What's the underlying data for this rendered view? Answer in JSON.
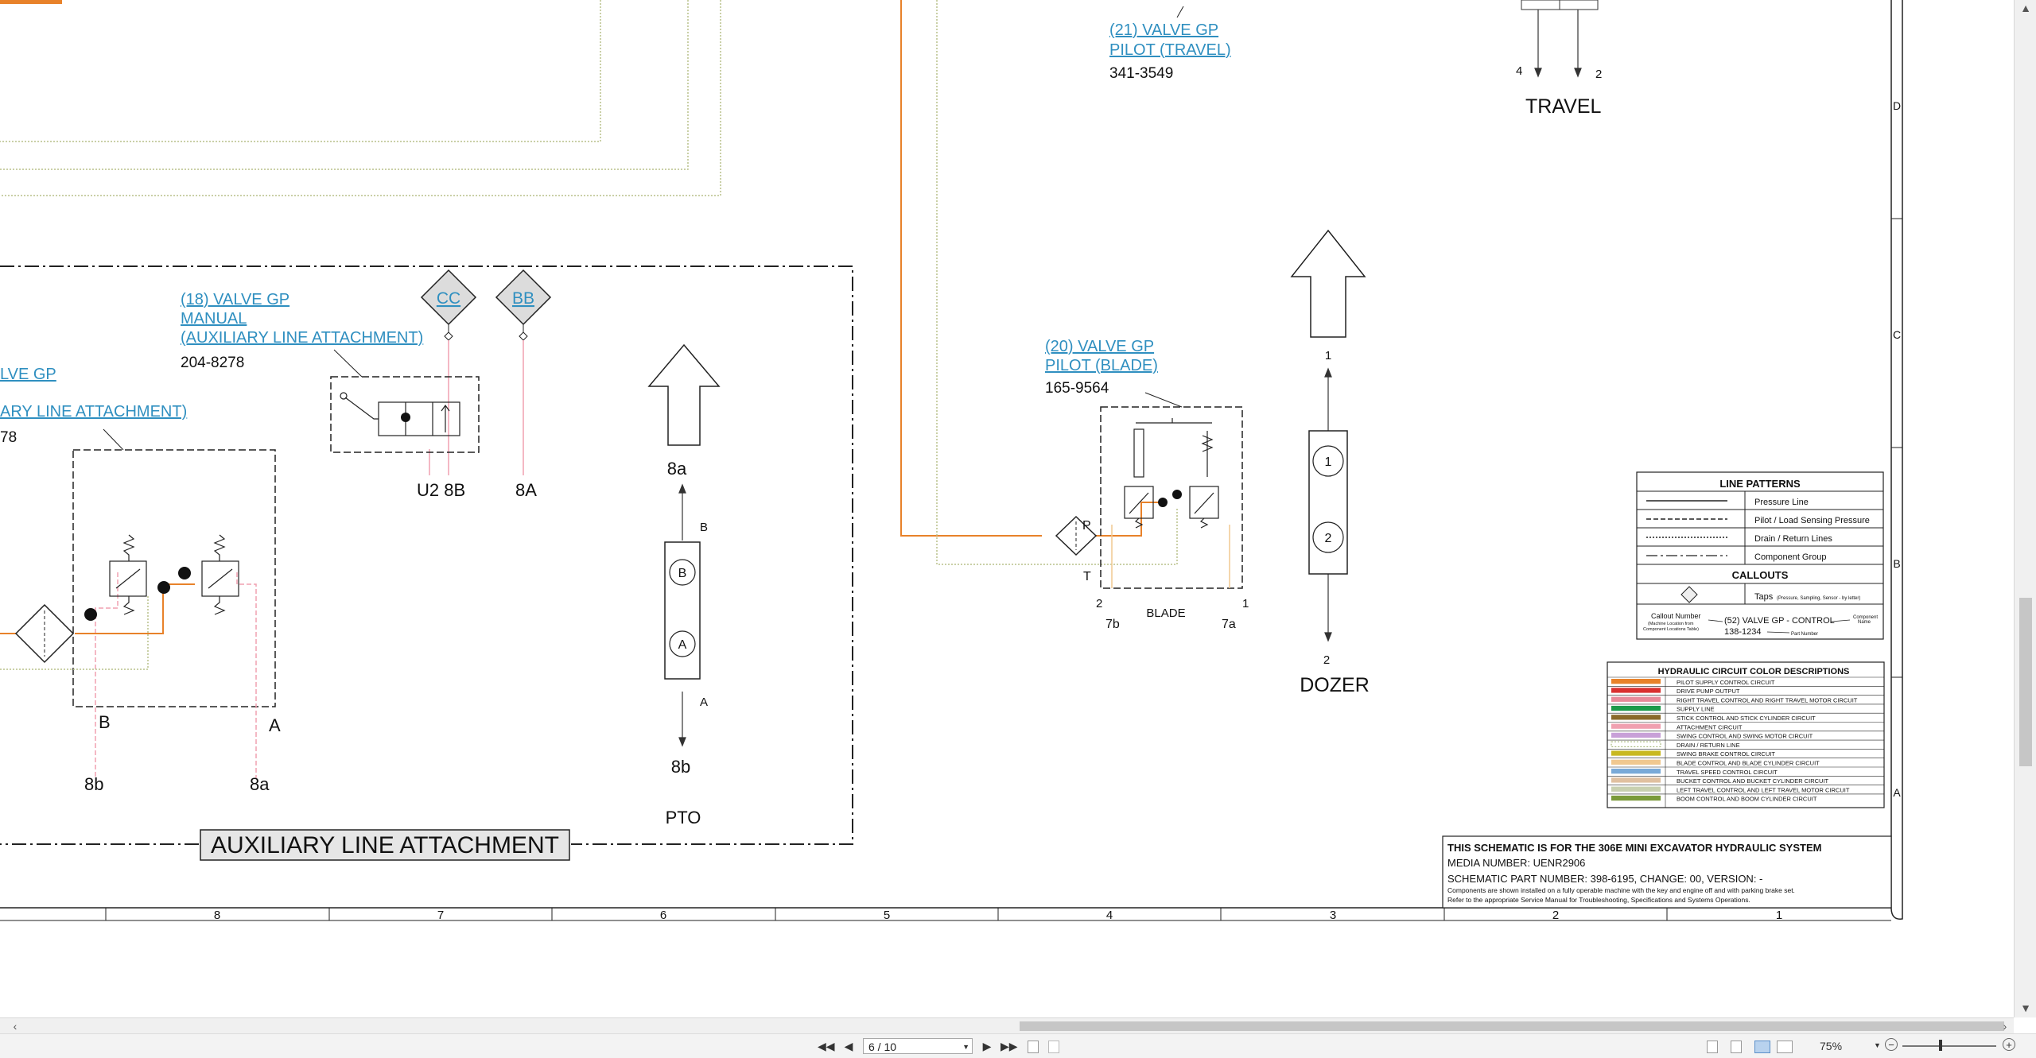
{
  "viewer": {
    "page_current": "6",
    "page_total": "10",
    "page_display": "6 / 10",
    "zoom": "75%"
  },
  "schematic": {
    "valve21": {
      "title1": "(21) VALVE GP",
      "title2": "PILOT (TRAVEL)",
      "part": "341-3549"
    },
    "travel": {
      "port_4": "4",
      "port_2": "2",
      "label": "TRAVEL"
    },
    "valve18": {
      "title1": "(18) VALVE GP",
      "title2": "MANUAL",
      "title3": "(AUXILIARY LINE ATTACHMENT)",
      "part": "204-8278"
    },
    "tap_cc": "CC",
    "tap_bb": "BB",
    "partial_valve": {
      "title1": "LVE GP",
      "title2": "ARY LINE ATTACHMENT)",
      "part": "78"
    },
    "ports_u2_8b": "U2 8B",
    "port_8A": "8A",
    "pto": {
      "port_8a": "8a",
      "b": "B",
      "a": "A",
      "port_8b": "8b",
      "label": "PTO",
      "circle_b": "B",
      "circle_a": "A"
    },
    "aux_valve_ports": {
      "B": "B",
      "A": "A",
      "8b": "8b",
      "8a": "8a"
    },
    "aux_group_label": "AUXILIARY LINE ATTACHMENT",
    "valve20": {
      "title1": "(20) VALVE GP",
      "title2": "PILOT (BLADE)",
      "part": "165-9564",
      "P": "P",
      "T": "T",
      "n2": "2",
      "n1": "1",
      "p7b": "7b",
      "p7a": "7a",
      "blade": "BLADE"
    },
    "dozer": {
      "n1": "1",
      "c1": "1",
      "c2": "2",
      "n2": "2",
      "label": "DOZER"
    },
    "border_rows": [
      "D",
      "C",
      "B",
      "A"
    ],
    "border_cols": [
      "8",
      "7",
      "6",
      "5",
      "4",
      "3",
      "2",
      "1"
    ]
  },
  "legend": {
    "line_patterns_title": "LINE PATTERNS",
    "line_patterns": [
      "Pressure Line",
      "Pilot / Load Sensing Pressure",
      "Drain / Return Lines",
      "Component Group"
    ],
    "callouts_title": "CALLOUTS",
    "taps_label": "Taps",
    "taps_note": "(Pressure, Sampling, Sensor - by letter)",
    "callout_number": "Callout Number",
    "callout_number_note1": "(Machine Location from",
    "callout_number_note2": "Component Locations Table)",
    "callout_example": "(52) VALVE GP - CONTROL",
    "callout_part": "138-1234",
    "component_name1": "Component",
    "component_name2": "Name",
    "part_number": "Part Number"
  },
  "colors_table": {
    "title": "HYDRAULIC CIRCUIT COLOR DESCRIPTIONS",
    "rows": [
      {
        "label": "PILOT SUPPLY CONTROL CIRCUIT",
        "color": "#e8822a"
      },
      {
        "label": "DRIVE PUMP OUTPUT",
        "color": "#d93030"
      },
      {
        "label": "RIGHT TRAVEL CONTROL AND RIGHT TRAVEL MOTOR CIRCUIT",
        "color": "#e88a9a"
      },
      {
        "label": "SUPPLY LINE",
        "color": "#1a9a4a"
      },
      {
        "label": "STICK CONTROL AND STICK CYLINDER CIRCUIT",
        "color": "#8a6a2a"
      },
      {
        "label": "ATTACHMENT CIRCUIT",
        "color": "#f0a0b0"
      },
      {
        "label": "SWING CONTROL AND SWING MOTOR CIRCUIT",
        "color": "#c8a0d8"
      },
      {
        "label": "DRAIN / RETURN LINE",
        "color": "#9aae6a"
      },
      {
        "label": "SWING BRAKE CONTROL CIRCUIT",
        "color": "#c8b820"
      },
      {
        "label": "BLADE CONTROL AND BLADE CYLINDER CIRCUIT",
        "color": "#f0c890"
      },
      {
        "label": "TRAVEL SPEED CONTROL CIRCUIT",
        "color": "#7aaad8"
      },
      {
        "label": "BUCKET CONTROL AND BUCKET CYLINDER CIRCUIT",
        "color": "#e0c0a0"
      },
      {
        "label": "LEFT TRAVEL CONTROL AND LEFT TRAVEL MOTOR CIRCUIT",
        "color": "#c8d0b0"
      },
      {
        "label": "BOOM CONTROL AND BOOM CYLINDER CIRCUIT",
        "color": "#7a9a3a"
      }
    ]
  },
  "titleblock": {
    "line1": "THIS SCHEMATIC IS FOR THE 306E MINI EXCAVATOR HYDRAULIC SYSTEM",
    "line2": "MEDIA NUMBER: UENR2906",
    "line3": "SCHEMATIC PART NUMBER: 398-6195, CHANGE: 00, VERSION: -",
    "line4": "Components are shown installed on a fully operable machine with the key and engine off and with parking brake set.",
    "line5": "Refer to the appropriate Service Manual for Troubleshooting, Specifications and Systems Operations."
  },
  "icons": [
    "first-page-icon",
    "prev-page-icon",
    "next-page-icon",
    "last-page-icon",
    "zoom-out-icon",
    "zoom-in-icon"
  ]
}
